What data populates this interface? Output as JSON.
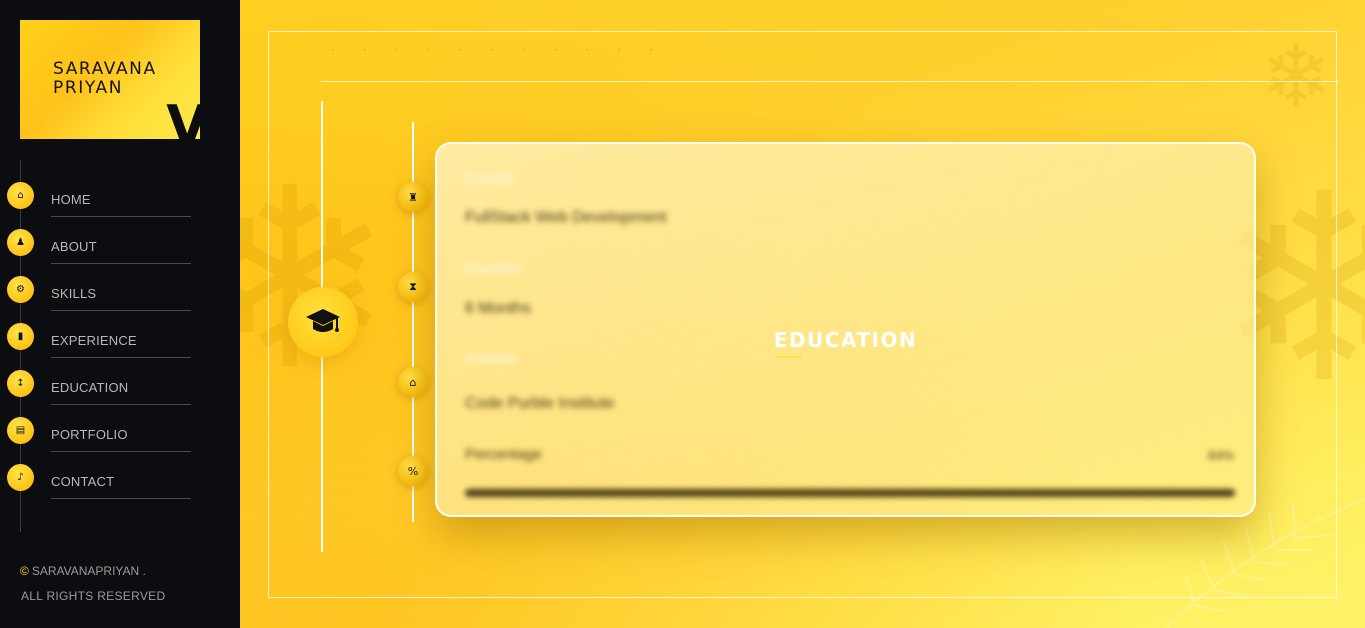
{
  "brand": {
    "line1": "SARAVANA",
    "line2": "PRIYAN",
    "mark": "V"
  },
  "nav": {
    "items": [
      {
        "label": "HOME",
        "icon": "home-icon",
        "glyph": "⌂"
      },
      {
        "label": "ABOUT",
        "icon": "user-icon",
        "glyph": "♟"
      },
      {
        "label": "SKILLS",
        "icon": "gear-icon",
        "glyph": "⚙"
      },
      {
        "label": "EXPERIENCE",
        "icon": "briefcase-icon",
        "glyph": "▮"
      },
      {
        "label": "EDUCATION",
        "icon": "graduation-icon",
        "glyph": "↕"
      },
      {
        "label": "PORTFOLIO",
        "icon": "portfolio-icon",
        "glyph": "▤"
      },
      {
        "label": "CONTACT",
        "icon": "phone-icon",
        "glyph": "♪"
      }
    ]
  },
  "footer": {
    "copyright_symbol": "©",
    "owner": "SARAVANAPRIYAN .",
    "rights": "ALL RIGHTS RESERVED"
  },
  "section": {
    "title": "EDUCATION",
    "badge_icon": "graduation-cap-icon"
  },
  "timeline": {
    "nodes": [
      {
        "icon": "course-icon",
        "glyph": "♜"
      },
      {
        "icon": "duration-icon",
        "glyph": "⧗"
      },
      {
        "icon": "institute-icon",
        "glyph": "⌂"
      },
      {
        "icon": "percentage-icon",
        "glyph": "%"
      }
    ]
  },
  "card": {
    "course_label": "Course",
    "course_value": "FullStack Web Development",
    "duration_label": "Duration",
    "duration_value": "6 Months",
    "institute_label": "Institute",
    "institute_value": "Code Purble Institute",
    "percentage_label": "Percentage",
    "percentage_value": "84%",
    "percentage_fraction": 1.0
  },
  "colors": {
    "accent": "#ffd21e",
    "sidebar_bg": "#0c0d10",
    "card_text": "#4a3b10"
  }
}
